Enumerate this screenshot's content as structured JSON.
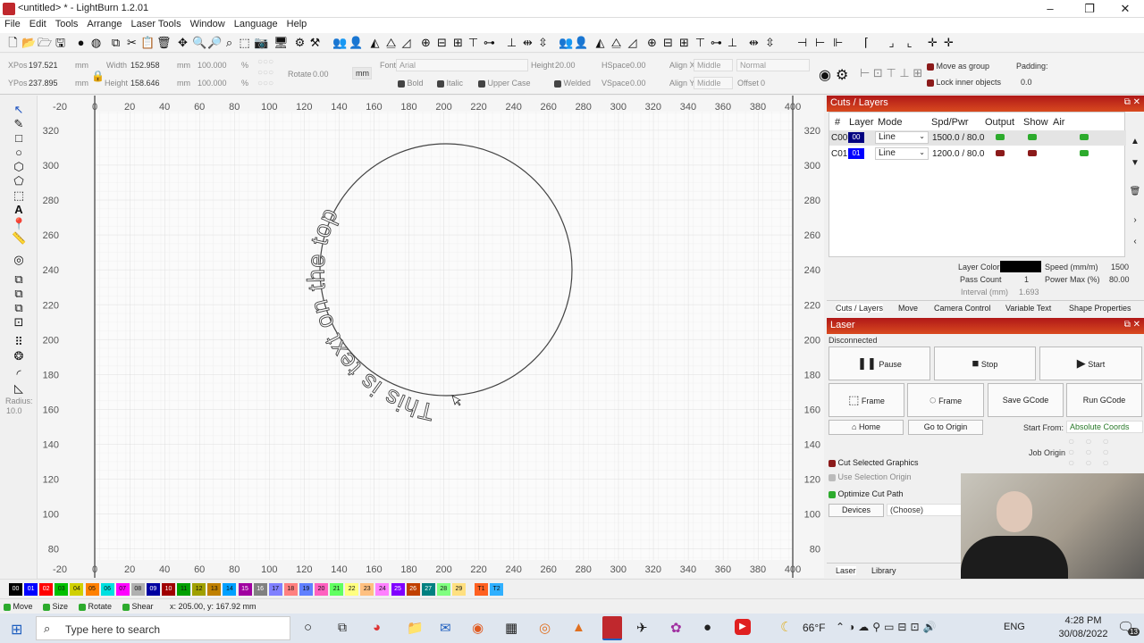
{
  "window": {
    "title": "<untitled> * - LightBurn 1.2.01",
    "controls": [
      "–",
      "❐",
      "✕"
    ]
  },
  "menu": [
    "File",
    "Edit",
    "Tools",
    "Arrange",
    "Laser Tools",
    "Window",
    "Language",
    "Help"
  ],
  "position": {
    "xpos_label": "XPos",
    "xpos": "197.521",
    "ypos_label": "YPos",
    "ypos": "237.895",
    "unit": "mm",
    "width_label": "Width",
    "width": "152.958",
    "height_label": "Height",
    "height": "158.646",
    "scale_w": "100.000",
    "scale_h": "100.000",
    "percent": "%",
    "rotate_label": "Rotate",
    "rotate": "0.00",
    "mm_button": "mm"
  },
  "text_props": {
    "font_label": "Font",
    "font": "Arial",
    "height_label": "Height",
    "height": "20.00",
    "hspace_label": "HSpace",
    "hspace": "0.00",
    "vspace_label": "VSpace",
    "vspace": "0.00",
    "alignx_label": "Align X",
    "alignx": "Middle",
    "aligny_label": "Align Y",
    "aligny": "Middle",
    "style": "Normal",
    "offset_label": "Offset",
    "offset": "0",
    "bold": "Bold",
    "italic": "Italic",
    "upper": "Upper Case",
    "welded": "Welded"
  },
  "group_opts": {
    "move_group": "Move as group",
    "lock_inner": "Lock inner objects",
    "padding_label": "Padding:",
    "padding": "0.0"
  },
  "left_tools": {
    "radius_label": "Radius:",
    "radius": "10.0"
  },
  "canvas": {
    "x_ticks": [
      "-20",
      "0",
      "20",
      "40",
      "60",
      "80",
      "100",
      "120",
      "140",
      "160",
      "180",
      "200",
      "220",
      "240",
      "260",
      "280",
      "300",
      "320",
      "340",
      "360",
      "380",
      "400"
    ],
    "y_ticks": [
      "320",
      "300",
      "280",
      "260",
      "240",
      "220",
      "200",
      "180",
      "160",
      "140",
      "120",
      "100",
      "80"
    ],
    "curved_text": "This is text on the top"
  },
  "cuts_panel": {
    "title": "Cuts / Layers",
    "headers": [
      "#",
      "Layer",
      "Mode",
      "Spd/Pwr",
      "Output",
      "Show",
      "Air"
    ],
    "rows": [
      {
        "id": "C00",
        "layer": "00",
        "color": "#000080",
        "mode": "Line",
        "spdpwr": "1500.0 / 80.0"
      },
      {
        "id": "C01",
        "layer": "01",
        "color": "#0000ff",
        "mode": "Line",
        "spdpwr": "1200.0 / 80.0"
      }
    ],
    "layer_color_label": "Layer Color",
    "speed_label": "Speed (mm/m)",
    "speed": "1500",
    "pass_label": "Pass Count",
    "pass": "1",
    "power_label": "Power Max (%)",
    "power": "80.00",
    "interval_label": "Interval (mm)",
    "interval": "1.693",
    "tabs": [
      "Cuts / Layers",
      "Move",
      "Camera Control",
      "Variable Text",
      "Shape Properties"
    ]
  },
  "laser_panel": {
    "title": "Laser",
    "status": "Disconnected",
    "pause": "Pause",
    "stop": "Stop",
    "start": "Start",
    "frame1": "Frame",
    "frame2": "Frame",
    "save_gcode": "Save GCode",
    "run_gcode": "Run GCode",
    "home": "Home",
    "go_origin": "Go to Origin",
    "start_from_label": "Start From:",
    "start_from": "Absolute Coords",
    "job_origin": "Job Origin",
    "cut_selected": "Cut Selected Graphics",
    "use_selection": "Use Selection Origin",
    "optimize": "Optimize Cut Path",
    "devices": "Devices",
    "choose": "(Choose)",
    "tabs": [
      "Laser",
      "Library"
    ]
  },
  "palette": [
    {
      "l": "00",
      "c": "#000000",
      "t": "#fff"
    },
    {
      "l": "01",
      "c": "#0000ff",
      "t": "#fff"
    },
    {
      "l": "02",
      "c": "#ff0000",
      "t": "#fff"
    },
    {
      "l": "03",
      "c": "#00c000",
      "t": "#111"
    },
    {
      "l": "04",
      "c": "#d0d000",
      "t": "#111"
    },
    {
      "l": "05",
      "c": "#ff8000",
      "t": "#111"
    },
    {
      "l": "06",
      "c": "#00e0e0",
      "t": "#111"
    },
    {
      "l": "07",
      "c": "#ff00ff",
      "t": "#111"
    },
    {
      "l": "08",
      "c": "#b0b0b0",
      "t": "#111"
    },
    {
      "l": "09",
      "c": "#0000a0",
      "t": "#fff"
    },
    {
      "l": "10",
      "c": "#a00000",
      "t": "#fff"
    },
    {
      "l": "11",
      "c": "#00a000",
      "t": "#111"
    },
    {
      "l": "12",
      "c": "#a0a000",
      "t": "#111"
    },
    {
      "l": "13",
      "c": "#c08000",
      "t": "#111"
    },
    {
      "l": "14",
      "c": "#00a0ff",
      "t": "#111"
    },
    {
      "l": "15",
      "c": "#a000a0",
      "t": "#fff"
    },
    {
      "l": "16",
      "c": "#808080",
      "t": "#fff"
    },
    {
      "l": "17",
      "c": "#8080ff",
      "t": "#111"
    },
    {
      "l": "18",
      "c": "#ff8080",
      "t": "#111"
    },
    {
      "l": "19",
      "c": "#6080ff",
      "t": "#111"
    },
    {
      "l": "20",
      "c": "#ff60c0",
      "t": "#111"
    },
    {
      "l": "21",
      "c": "#60ff60",
      "t": "#111"
    },
    {
      "l": "22",
      "c": "#ffff80",
      "t": "#111"
    },
    {
      "l": "23",
      "c": "#ffc080",
      "t": "#111"
    },
    {
      "l": "24",
      "c": "#ff80ff",
      "t": "#111"
    },
    {
      "l": "25",
      "c": "#8000ff",
      "t": "#fff"
    },
    {
      "l": "26",
      "c": "#c04000",
      "t": "#fff"
    },
    {
      "l": "27",
      "c": "#008080",
      "t": "#fff"
    },
    {
      "l": "28",
      "c": "#80ff80",
      "t": "#111"
    },
    {
      "l": "29",
      "c": "#ffe080",
      "t": "#111"
    },
    {
      "l": "T1",
      "c": "#ff6020",
      "t": "#111"
    },
    {
      "l": "T2",
      "c": "#30b0ff",
      "t": "#111"
    }
  ],
  "status": {
    "move": "Move",
    "size": "Size",
    "rotate": "Rotate",
    "shear": "Shear",
    "coords": "x: 205.00, y: 167.92 mm"
  },
  "taskbar": {
    "search": "Type here to search",
    "weather": "66°F",
    "lang": "ENG",
    "time": "4:28 PM",
    "date": "30/08/2022",
    "notif": "13"
  }
}
